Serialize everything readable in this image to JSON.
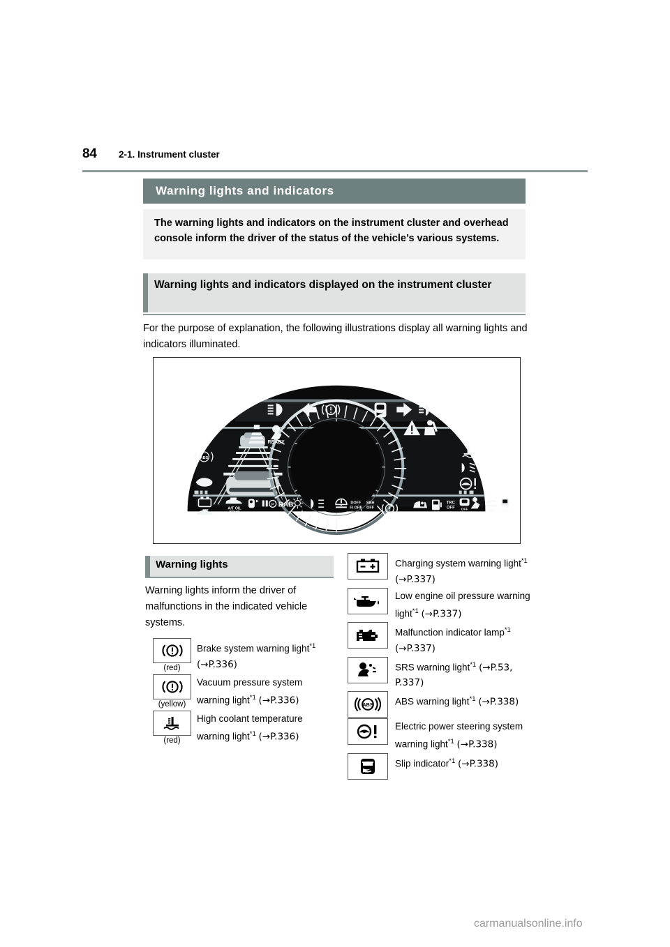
{
  "page": {
    "number": "84",
    "chapter": "2-1. Instrument cluster",
    "watermark": "carmanualsonline.info"
  },
  "colors": {
    "section_bar": "#6e807f",
    "sub_head_bg": "#dfe2e0",
    "sub_head_accent": "#7f8d8c",
    "intro_bg": "#f1f2f1",
    "rule": "#8b9a99"
  },
  "section": {
    "title": "Warning lights and indicators",
    "intro": "The warning lights and indicators on the instrument cluster and overhead console inform the driver of the status of the vehicle’s various systems.",
    "sub_head": "Warning lights and indicators displayed on the instrument cluster",
    "body": "For the purpose of explanation, the following illustrations display all warning lights and indicators illuminated."
  },
  "illustration": {
    "name": "instrument-cluster-diagram",
    "display_label": "SNOW",
    "ready_label": "READY",
    "labels": [
      "READY",
      "A/T OIL TEMP",
      "RAB",
      "DOFF FI OFF",
      "SBH OFF",
      "TRC OFF",
      "OFF",
      "SNOW"
    ]
  },
  "warning_lights": {
    "head": "Warning lights",
    "intro": "Warning lights inform the driver of malfunctions in the indicated vehicle systems.",
    "left_rows": [
      {
        "icon": "brake-system-warning-icon",
        "color_note": "(red)",
        "text": "Brake system warning light",
        "footnote": "*1",
        "ref": "(→P.336)"
      },
      {
        "icon": "vacuum-pressure-warning-icon",
        "color_note": "(yellow)",
        "text": "Vacuum pressure system warning light",
        "footnote": "*1",
        "ref": "(→P.336)"
      },
      {
        "icon": "high-coolant-temperature-icon",
        "color_note": "(red)",
        "text": "High coolant temperature warning light",
        "footnote": "*1",
        "ref": "(→P.336)"
      }
    ],
    "right_rows": [
      {
        "icon": "charging-system-warning-icon",
        "text": "Charging system warning light",
        "footnote": "*1",
        "ref": "(→P.337)"
      },
      {
        "icon": "low-engine-oil-pressure-icon",
        "text": "Low engine oil pressure warning light",
        "footnote": "*1",
        "ref": "(→P.337)"
      },
      {
        "icon": "malfunction-indicator-lamp-icon",
        "text": "Malfunction indicator lamp",
        "footnote": "*1",
        "ref": "(→P.337)"
      },
      {
        "icon": "srs-warning-icon",
        "text": "SRS warning light",
        "footnote": "*1",
        "ref": "(→P.53, P.337)"
      },
      {
        "icon": "abs-warning-icon",
        "text": "ABS warning light",
        "footnote": "*1",
        "ref": "(→P.338)"
      },
      {
        "icon": "electric-power-steering-icon",
        "text": "Electric power steering system warning light",
        "footnote": "*1",
        "ref": "(→P.338)"
      },
      {
        "icon": "slip-indicator-icon",
        "text": "Slip indicator",
        "footnote": "*1",
        "ref": "(→P.338)"
      }
    ]
  }
}
